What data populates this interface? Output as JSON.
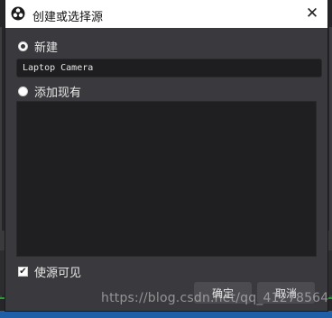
{
  "dialog": {
    "title": "创建或选择源",
    "close_glyph": "✕",
    "icons": {
      "app": "obs-logo-icon",
      "close": "close-icon"
    }
  },
  "create_new": {
    "label": "新建",
    "selected": true,
    "name_value": "Laptop Camera"
  },
  "add_existing": {
    "label": "添加现有",
    "selected": false,
    "items": []
  },
  "visibility": {
    "label": "使源可见",
    "checked": true
  },
  "buttons": {
    "ok": "确定",
    "cancel": "取消"
  },
  "watermark": "https://blog.csdn.net/qq_41278564"
}
